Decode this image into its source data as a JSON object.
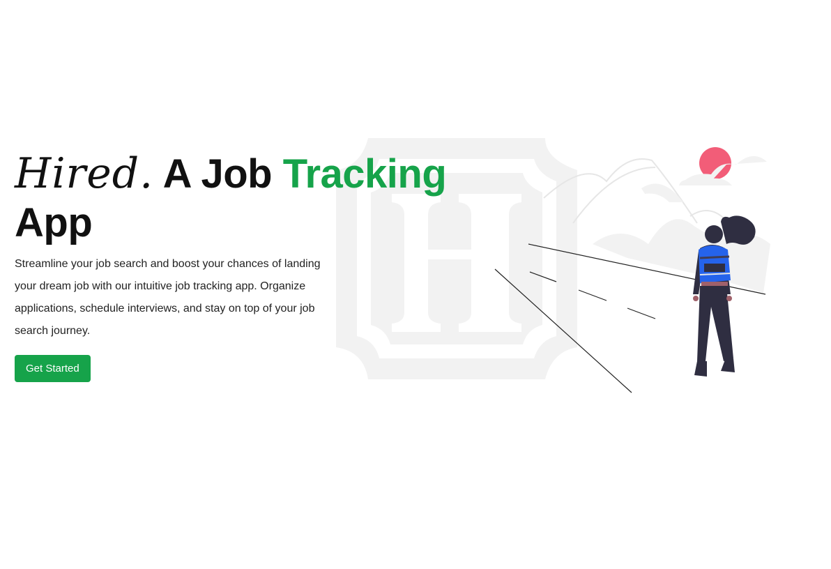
{
  "hero": {
    "brand": "Hired.",
    "title_part1": " A Job ",
    "title_accent": "Tracking",
    "title_part2": "App",
    "description": "Streamline your job search and boost your chances of landing your dream job with our intuitive job tracking app. Organize applications, schedule interviews, and stay on top of your job search journey.",
    "cta_label": "Get Started"
  },
  "colors": {
    "accent": "#16a34a",
    "heading": "#111111",
    "sun": "#f25d78",
    "backpack": "#2563eb",
    "figure": "#2f2e41",
    "watermark": "#f2f2f2"
  },
  "icons": {
    "background_mark": "hired-h-logo-icon",
    "illustration": "traveler-woman-illustration"
  }
}
